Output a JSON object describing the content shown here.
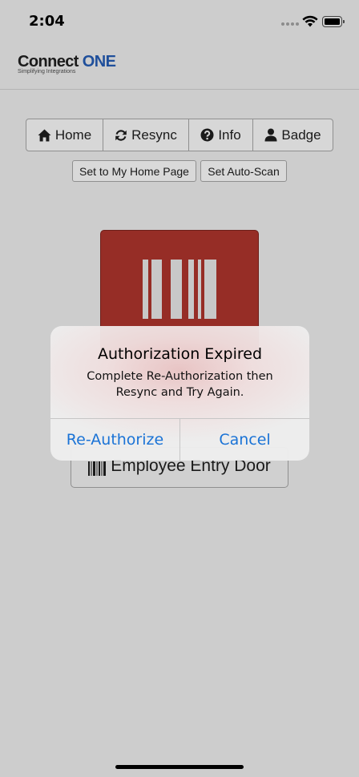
{
  "status_bar": {
    "time": "2:04",
    "icons": [
      "cellular-signal-icon",
      "wifi-icon",
      "battery-icon"
    ]
  },
  "header": {
    "logo_main": "Connect",
    "logo_accent": "ONE",
    "logo_tagline": "Simplifying Integrations",
    "colors": {
      "accent": "#1f4f9b"
    }
  },
  "nav": {
    "items": [
      {
        "label": "Home",
        "icon": "home-icon"
      },
      {
        "label": "Resync",
        "icon": "refresh-icon"
      },
      {
        "label": "Info",
        "icon": "info-icon"
      },
      {
        "label": "Badge",
        "icon": "user-icon"
      }
    ]
  },
  "actions": {
    "set_home": "Set to My Home Page",
    "set_auto_scan": "Set Auto-Scan"
  },
  "scan_tile": {
    "icon": "barcode-icon",
    "color": "#962d26"
  },
  "door_button": {
    "icon": "barcode-icon",
    "label": "Employee Entry Door"
  },
  "alert": {
    "title": "Authorization Expired",
    "message": "Complete Re-Authorization then Resync and Try Again.",
    "buttons": {
      "primary": "Re-Authorize",
      "cancel": "Cancel"
    },
    "button_color": "#1a73d6"
  }
}
